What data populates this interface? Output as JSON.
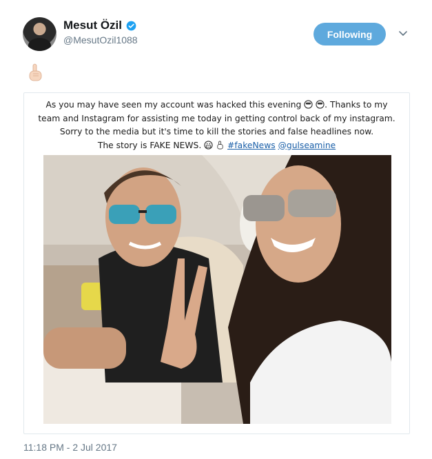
{
  "user": {
    "display_name": "Mesut Özil",
    "handle": "@MesutOzil1088",
    "verified_icon": "verified-badge-icon"
  },
  "follow_button": {
    "label": "Following"
  },
  "menu_icon": "chevron-down-icon",
  "tweet": {
    "emoji": "pointing-up-hand-icon",
    "caption": {
      "line1": "As you may have seen my account was hacked this evening",
      "line1_tail": ". Thanks to my",
      "line2": "team and Instagram for assisting me today in getting control back of my instagram.",
      "line3": "Sorry to the media but it's time to kill the stories and false headlines now.",
      "line4": "The story is FAKE NEWS.",
      "hashtag": "#fakeNews",
      "mention": "@gulseamine"
    },
    "timestamp": "11:18 PM - 2 Jul 2017"
  },
  "colors": {
    "follow_bg": "#5ea9dd",
    "verified": "#1da1f2",
    "secondary_text": "#657786",
    "link": "#1a5fa8"
  }
}
